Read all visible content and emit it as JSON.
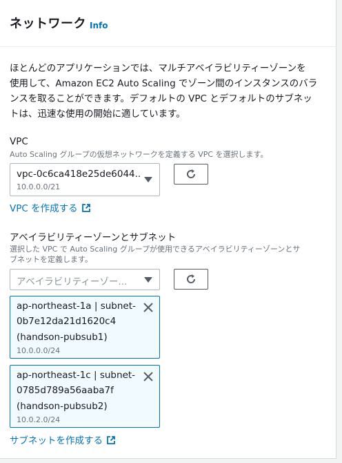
{
  "header": {
    "title": "ネットワーク",
    "info_link": "Info"
  },
  "description": {
    "line1": "ほとんどのアプリケーションでは、マルチアベイラビリティーゾーンを",
    "line2": "使用して、Amazon EC2 Auto Scaling でゾーン間のインスタンスのバラ",
    "line3": "ンスを取ることができます。デフォルトの VPC とデフォルトのサブネッ",
    "line4": "トは、迅速な使用の開始に適しています。"
  },
  "vpc": {
    "label": "VPC",
    "hint": "Auto Scaling グループの仮想ネットワークを定義する VPC を選択します。",
    "selected_id": "vpc-0c6ca418e25de6044...",
    "selected_cidr": "10.0.0.0/21",
    "create_link": "VPC を作成する"
  },
  "subnets": {
    "label": "アベイラビリティーゾーンとサブネット",
    "hint_line1": "選択した VPC で Auto Scaling グループが使用できるアベイラビリティーゾーンとサ",
    "hint_line2": "ブネットを定義します。",
    "placeholder": "アベイラビリティーゾー...",
    "selected": [
      {
        "line1": "ap-northeast-1a | subnet-",
        "line2": "0b7e12da21d1620c4",
        "line3": "(handson-pubsub1)",
        "cidr": "10.0.0.0/24"
      },
      {
        "line1": "ap-northeast-1c | subnet-",
        "line2": "0785d789a56aaba7f",
        "line3": "(handson-pubsub2)",
        "cidr": "10.0.2.0/24"
      }
    ],
    "create_link": "サブネットを作成する"
  },
  "icons": {
    "refresh": "refresh-icon",
    "caret": "caret-down-icon",
    "external": "external-link-icon",
    "close": "close-icon"
  },
  "colors": {
    "link": "#0073bb",
    "token_bg": "#f1faff",
    "token_border": "#0073bb"
  }
}
